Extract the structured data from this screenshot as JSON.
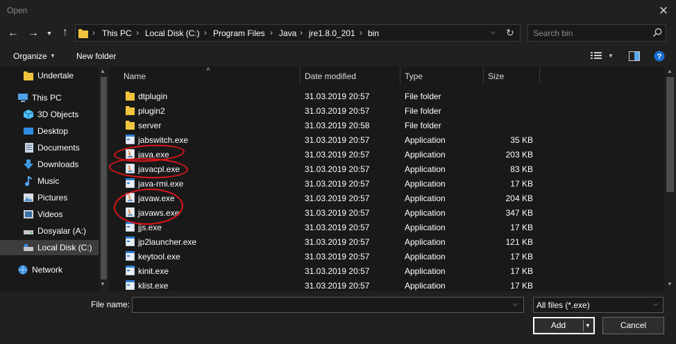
{
  "window": {
    "title": "Open"
  },
  "breadcrumbs": [
    "This PC",
    "Local Disk (C:)",
    "Program Files",
    "Java",
    "jre1.8.0_201",
    "bin"
  ],
  "search": {
    "placeholder": "Search bin"
  },
  "toolbar": {
    "organize_label": "Organize",
    "new_folder_label": "New folder"
  },
  "sidebar": {
    "items": [
      {
        "label": "Undertale",
        "icon": "folder-icon"
      },
      {
        "label": "This PC",
        "icon": "pc-icon"
      },
      {
        "label": "3D Objects",
        "icon": "cube-icon"
      },
      {
        "label": "Desktop",
        "icon": "desktop-icon"
      },
      {
        "label": "Documents",
        "icon": "documents-icon"
      },
      {
        "label": "Downloads",
        "icon": "download-icon"
      },
      {
        "label": "Music",
        "icon": "music-icon"
      },
      {
        "label": "Pictures",
        "icon": "pictures-icon"
      },
      {
        "label": "Videos",
        "icon": "videos-icon"
      },
      {
        "label": "Dosyalar (A:)",
        "icon": "drive-icon"
      },
      {
        "label": "Local Disk (C:)",
        "icon": "drive-icon"
      },
      {
        "label": "Network",
        "icon": "network-icon"
      }
    ]
  },
  "columns": {
    "name": "Name",
    "date": "Date modified",
    "type": "Type",
    "size": "Size"
  },
  "files": [
    {
      "name": "dtplugin",
      "date": "31.03.2019 20:57",
      "type": "File folder",
      "size": "",
      "kind": "folder"
    },
    {
      "name": "plugin2",
      "date": "31.03.2019 20:57",
      "type": "File folder",
      "size": "",
      "kind": "folder"
    },
    {
      "name": "server",
      "date": "31.03.2019 20:58",
      "type": "File folder",
      "size": "",
      "kind": "folder"
    },
    {
      "name": "jabswitch.exe",
      "date": "31.03.2019 20:57",
      "type": "Application",
      "size": "35 KB",
      "kind": "app"
    },
    {
      "name": "java.exe",
      "date": "31.03.2019 20:57",
      "type": "Application",
      "size": "203 KB",
      "kind": "java"
    },
    {
      "name": "javacpl.exe",
      "date": "31.03.2019 20:57",
      "type": "Application",
      "size": "83 KB",
      "kind": "java"
    },
    {
      "name": "java-rmi.exe",
      "date": "31.03.2019 20:57",
      "type": "Application",
      "size": "17 KB",
      "kind": "app"
    },
    {
      "name": "javaw.exe",
      "date": "31.03.2019 20:57",
      "type": "Application",
      "size": "204 KB",
      "kind": "java"
    },
    {
      "name": "javaws.exe",
      "date": "31.03.2019 20:57",
      "type": "Application",
      "size": "347 KB",
      "kind": "java"
    },
    {
      "name": "jjs.exe",
      "date": "31.03.2019 20:57",
      "type": "Application",
      "size": "17 KB",
      "kind": "app"
    },
    {
      "name": "jp2launcher.exe",
      "date": "31.03.2019 20:57",
      "type": "Application",
      "size": "121 KB",
      "kind": "app"
    },
    {
      "name": "keytool.exe",
      "date": "31.03.2019 20:57",
      "type": "Application",
      "size": "17 KB",
      "kind": "app"
    },
    {
      "name": "kinit.exe",
      "date": "31.03.2019 20:57",
      "type": "Application",
      "size": "17 KB",
      "kind": "app"
    },
    {
      "name": "klist.exe",
      "date": "31.03.2019 20:57",
      "type": "Application",
      "size": "17 KB",
      "kind": "app"
    }
  ],
  "bottom": {
    "file_name_label": "File name:",
    "file_name_value": "",
    "filter_value": "All files (*.exe)",
    "add_label": "Add",
    "cancel_label": "Cancel"
  },
  "colors": {
    "background": "#202020",
    "list_background": "#191919",
    "selected": "#3d3d3d",
    "annotation": "#e0161a"
  }
}
